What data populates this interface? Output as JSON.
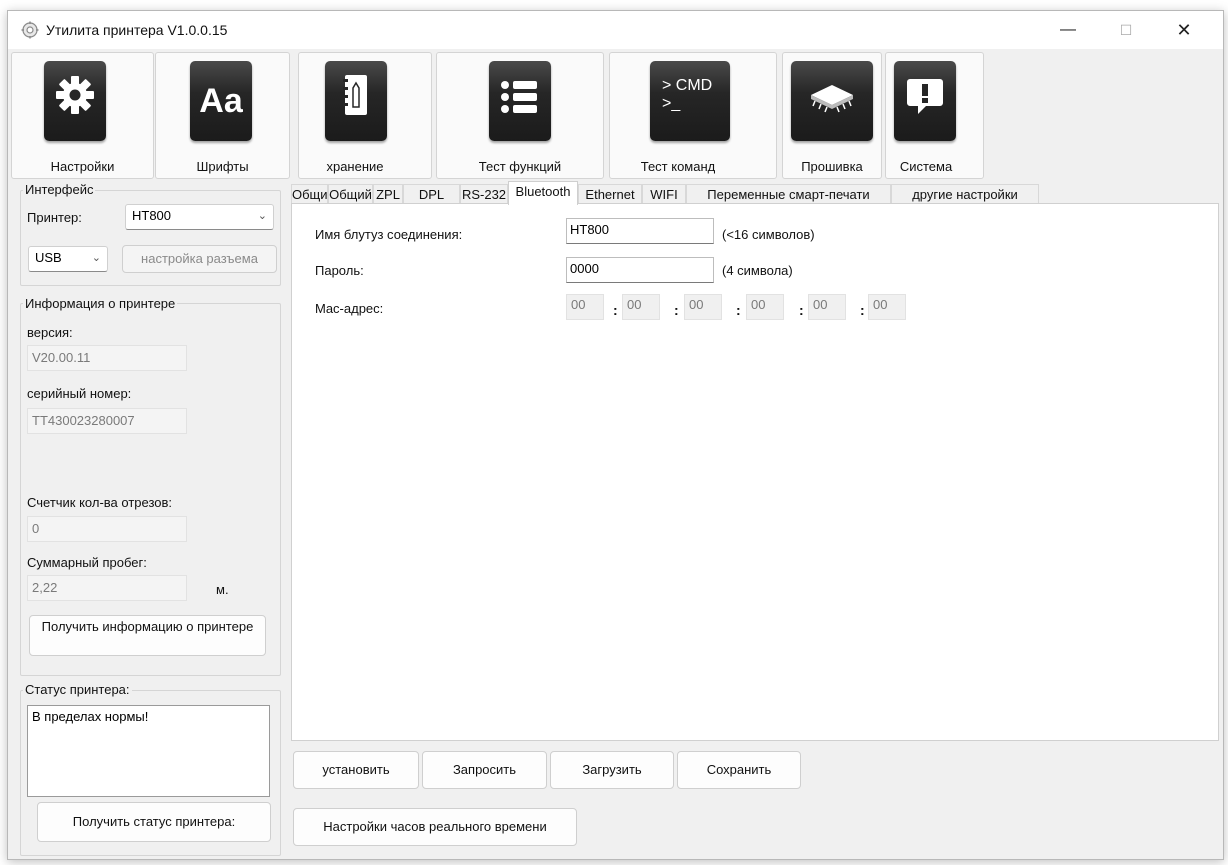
{
  "window": {
    "title": "Утилита принтера  V1.0.0.15",
    "minimize": "—",
    "maximize": "☐",
    "close": "✕"
  },
  "toolbar": {
    "settings": "Настройки",
    "fonts": "Шрифты",
    "fonts_icon_text": "Aa",
    "storage": "хранение",
    "function_test": "Тест функций",
    "command_test": "Тест команд",
    "cmd_icon_line1": "> CMD",
    "cmd_icon_line2": ">_",
    "firmware": "Прошивка",
    "system": "Система"
  },
  "sidebar": {
    "interface_group": "Интерфейс",
    "printer_label": "Принтер:",
    "printer_value": "HT800",
    "port_value": "USB",
    "port_settings_button": "настройка разъема",
    "info_group": "Информация о принтере",
    "version_label": "версия:",
    "version_value": "V20.00.11",
    "serial_label": "серийный номер:",
    "serial_value": "TT430023280007",
    "cut_counter_label": "Счетчик кол-ва отрезов:",
    "cut_counter_value": "0",
    "mileage_label": "Суммарный пробег:",
    "mileage_value": "2,22",
    "mileage_unit": "м.",
    "get_info_button": "Получить информацию о принтере",
    "status_group": "Статус принтера:",
    "status_text": "В пределах нормы!",
    "get_status_button": "Получить статус принтера:"
  },
  "tabs": [
    {
      "label": "Общий"
    },
    {
      "label": "Общий"
    },
    {
      "label": "ZPL"
    },
    {
      "label": "DPL"
    },
    {
      "label": "RS-232"
    },
    {
      "label": "Bluetooth"
    },
    {
      "label": "Ethernet"
    },
    {
      "label": "WIFI"
    },
    {
      "label": "Переменные смарт-печати"
    },
    {
      "label": "другие настройки"
    }
  ],
  "active_tab": "Bluetooth",
  "bluetooth": {
    "name_label": "Имя блутуз соединения:",
    "name_value": "HT800",
    "name_hint": "(<16 символов)",
    "password_label": "Пароль:",
    "password_value": "0000",
    "password_hint": "(4 символа)",
    "mac_label": "Mac-адрес:",
    "mac": [
      "00",
      "00",
      "00",
      "00",
      "00",
      "00"
    ],
    "mac_separator": ":"
  },
  "actions": {
    "set": "установить",
    "query": "Запросить",
    "load": "Загрузить",
    "save": "Сохранить",
    "rtc_settings": "Настройки часов реального времени"
  }
}
